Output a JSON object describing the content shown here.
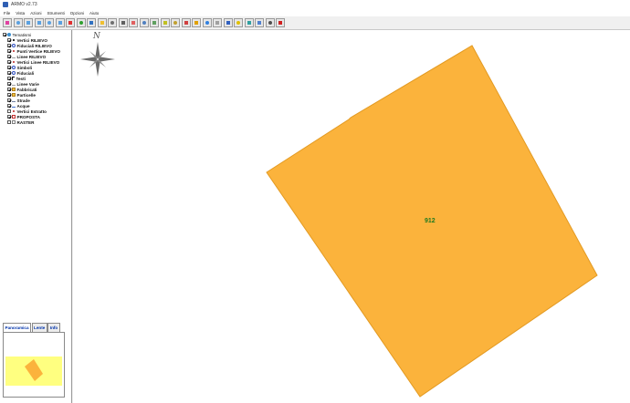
{
  "window": {
    "title": "ARMO v2.73"
  },
  "menu": [
    "File",
    "Vista",
    "Azioni",
    "Strumenti",
    "Opzioni",
    "Aiuto"
  ],
  "toolbar": {
    "buttons": [
      {
        "icon": "refresh-icon",
        "color": "#e040a0"
      },
      {
        "icon": "zoom-icon",
        "color": "#5aa0e0"
      },
      {
        "icon": "zoom-window-icon",
        "color": "#5aa0e0"
      },
      {
        "icon": "pan-icon",
        "color": "#5aa0e0"
      },
      {
        "icon": "zoom-in-icon",
        "color": "#5aa0e0"
      },
      {
        "icon": "zoom-out-icon",
        "color": "#5aa0e0"
      },
      {
        "icon": "map-icon",
        "color": "#e03030"
      },
      {
        "icon": "grid-icon",
        "color": "#30a030"
      },
      {
        "icon": "globe-icon",
        "color": "#3070c0"
      },
      {
        "icon": "select-icon",
        "color": "#f0c030"
      },
      {
        "icon": "cursor-icon",
        "color": "#707070"
      },
      {
        "icon": "print-icon",
        "color": "#606060"
      },
      {
        "icon": "layer-icon",
        "color": "#e06060"
      },
      {
        "icon": "line-icon",
        "color": "#5080c0"
      },
      {
        "icon": "image-icon",
        "color": "#60a060"
      },
      {
        "icon": "measure-icon",
        "color": "#c0c020"
      },
      {
        "icon": "area-icon",
        "color": "#c0a030"
      },
      {
        "icon": "point-icon",
        "color": "#d04040"
      },
      {
        "icon": "text-icon",
        "color": "#e0a000"
      },
      {
        "icon": "settings-icon",
        "color": "#3080e0"
      },
      {
        "icon": "vertex-icon",
        "color": "#a0a0a0"
      },
      {
        "icon": "edit-icon",
        "color": "#3060c0"
      },
      {
        "icon": "pen-icon",
        "color": "#e0c000"
      },
      {
        "icon": "note-icon",
        "color": "#30a0a0"
      },
      {
        "icon": "export-icon",
        "color": "#5080d0"
      },
      {
        "icon": "printer-icon",
        "color": "#505050"
      },
      {
        "icon": "close-icon",
        "color": "#d02020"
      }
    ]
  },
  "tree": {
    "root": "Tematismi",
    "items": [
      {
        "label": "Vertici RILIEVO",
        "checked": true,
        "icon": "asterisk-icon",
        "color": "#000000"
      },
      {
        "label": "Fiduciali RILIEVO",
        "checked": true,
        "icon": "target-icon",
        "color": "#3050c0"
      },
      {
        "label": "Punti Vertice RILIEVO",
        "checked": true,
        "icon": "triangle-icon",
        "color": "#c03030"
      },
      {
        "label": "Linee RILIEVO",
        "checked": true,
        "icon": "line-icon",
        "color": "#a0a0a0"
      },
      {
        "label": "Vertici Linee RILIEVO",
        "checked": true,
        "icon": "asterisk-icon",
        "color": "#c03030"
      },
      {
        "label": "Simboli",
        "checked": true,
        "icon": "symbol-icon",
        "color": "#3050c0"
      },
      {
        "label": "Fiduciali",
        "checked": true,
        "icon": "target-icon",
        "color": "#3050c0"
      },
      {
        "label": "Testi",
        "checked": true,
        "icon": "text-icon",
        "color": "#000000"
      },
      {
        "label": "Linee Varie",
        "checked": true,
        "icon": "line-icon",
        "color": "#a0a0a0"
      },
      {
        "label": "Fabbricati",
        "checked": true,
        "icon": "fill-icon",
        "color": "#f0c040"
      },
      {
        "label": "Particelle",
        "checked": true,
        "icon": "fill-icon",
        "color": "#f0c040"
      },
      {
        "label": "Strade",
        "checked": true,
        "icon": "road-icon",
        "color": "#7080a0"
      },
      {
        "label": "Acque",
        "checked": true,
        "icon": "water-icon",
        "color": "#4070d0"
      },
      {
        "label": "Vertici Estratto",
        "checked": false,
        "icon": "asterisk-icon",
        "color": "#c03030"
      },
      {
        "label": "PROPOSTA",
        "checked": true,
        "icon": "proposal-icon",
        "color": "#c03030"
      },
      {
        "label": "RASTER",
        "checked": false,
        "icon": "raster-icon",
        "color": "#808080"
      }
    ]
  },
  "panel_tabs": [
    "Panoramica",
    "Lente",
    "Info"
  ],
  "map": {
    "north_label": "N",
    "parcel_label": "912",
    "parcel_color": "#fbb33c",
    "parcel_stroke": "#e39a22",
    "overview_bg": "#ffff80"
  }
}
